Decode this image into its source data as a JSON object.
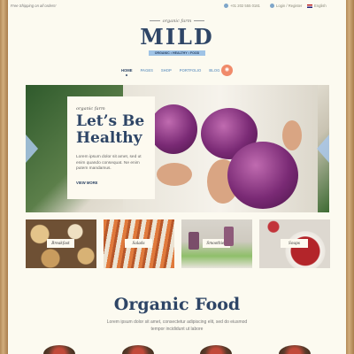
{
  "topbar": {
    "shipping": "Free Shipping on all orders!",
    "phone": "+01 202 555 0181",
    "login": "Login / Register",
    "language": "English"
  },
  "logo": {
    "tagline": "organic farm",
    "name": "MILD",
    "subtitle": "ORGANIC • HEALTHY • FOOD"
  },
  "nav": {
    "items": [
      "HOME",
      "PAGES",
      "SHOP",
      "PORTFOLIO",
      "BLOG"
    ],
    "active": "HOME"
  },
  "hero": {
    "small": "organic farm",
    "title": "Let’s Be Healthy",
    "text": "Lorem ipsum dolor sit amet, sed ut enim quando consequat. Ne enim putem mandamus.",
    "link": "VIEW MORE"
  },
  "tiles": [
    {
      "label": "Breakfast"
    },
    {
      "label": "Salads"
    },
    {
      "label": "Smoothies"
    },
    {
      "label": "Soups"
    }
  ],
  "section": {
    "title": "Organic Food",
    "text": "Lorem ipsum dolor sit amet, consectetur adipiscing elit, sed do eiusmod tempor incididunt ut labore"
  },
  "colors": {
    "brand": "#2e4566",
    "accent": "#7fa6c9",
    "cart": "#f08a6a",
    "background": "#fcfaf0"
  }
}
